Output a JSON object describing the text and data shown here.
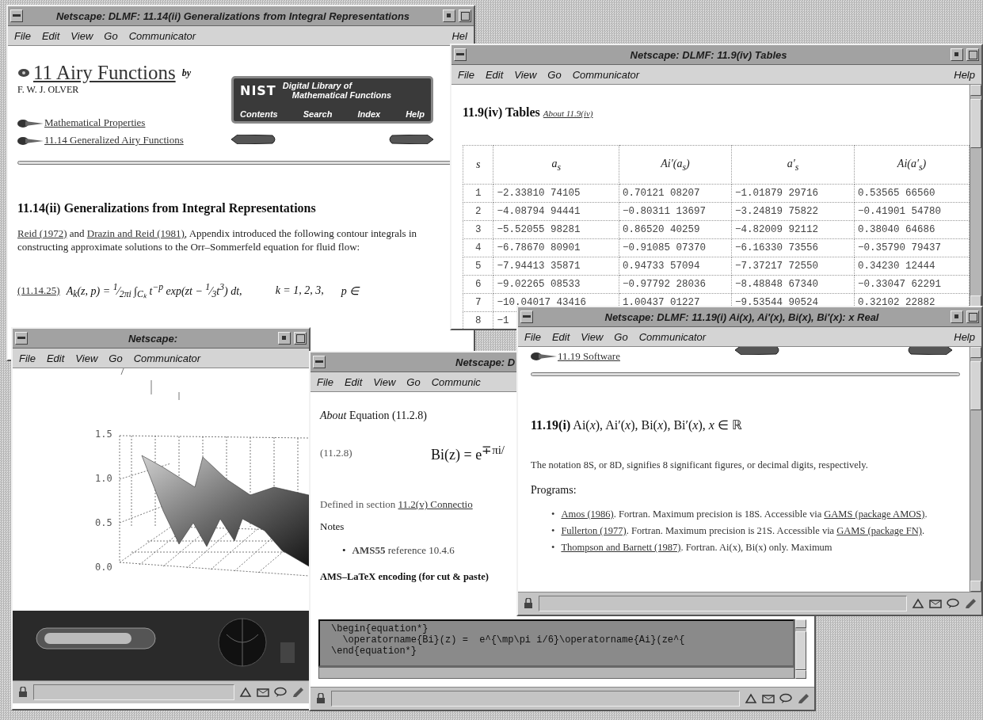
{
  "desktop": {
    "windows": [
      {
        "kind": "toc-page",
        "title": "Netscape: DLMF: 11.14(ii) Generalizations from Integral Representations",
        "menu": [
          "File",
          "Edit",
          "View",
          "Go",
          "Communicator"
        ],
        "help": "Hel",
        "chapter_link": "11 Airy Functions",
        "byline": "by",
        "author": "F. W. J. OLVER",
        "banner": {
          "logo": "NIST",
          "title_1": "Digital Library of",
          "title_2": "Mathematical Functions",
          "links": [
            "Contents",
            "Search",
            "Index",
            "Help"
          ]
        },
        "nav_links": [
          "Mathematical Properties",
          "11.14 Generalized Airy Functions"
        ],
        "heading": "11.14(ii) Generalizations from Integral Representations",
        "paragraph": [
          {
            "text": "Reid (1972)",
            "link": true
          },
          {
            "text": " and ",
            "link": false
          },
          {
            "text": "Drazin and Reid (1981)",
            "link": true
          },
          {
            "text": ", Appendix introduced the following contour integrals in constructing approximate solutions to the Orr–Sommerfeld equation for fluid flow:",
            "link": false
          }
        ],
        "equation": {
          "label": "(11.14.25)",
          "formula": "A$_{k}$(z, p) = $^{1}$⁄$_{2πi}$ ∫$_{Cₖ}$ t$^{−p}$ exp(zt − $^{1}$⁄$_{3}$t$^{3}$) dt,",
          "range": "k = 1, 2, 3,",
          "domain": "p ∈"
        }
      },
      {
        "kind": "table-page",
        "title": "Netscape: DLMF: 11.9(iv) Tables",
        "menu": [
          "File",
          "Edit",
          "View",
          "Go",
          "Communicator"
        ],
        "help": "Help",
        "heading": "11.9(iv) Tables",
        "about_link": "About 11.9(iv)",
        "table": {
          "columns": [
            "s",
            "a$_{s}$",
            "Ai′(a$_{s}$)",
            "a′$_{s}$",
            "Ai(a′$_{s}$)"
          ],
          "rows": [
            [
              "1",
              "−2.33810 74105",
              "0.70121 08207",
              "−1.01879 29716",
              "0.53565 66560"
            ],
            [
              "2",
              "−4.08794 94441",
              "−0.80311 13697",
              "−3.24819 75822",
              "−0.41901 54780"
            ],
            [
              "3",
              "−5.52055 98281",
              "0.86520 40259",
              "−4.82009 92112",
              "0.38040 64686"
            ],
            [
              "4",
              "−6.78670 80901",
              "−0.91085 07370",
              "−6.16330 73556",
              "−0.35790 79437"
            ],
            [
              "5",
              "−7.94413 35871",
              "0.94733 57094",
              "−7.37217 72550",
              "0.34230 12444"
            ],
            [
              "6",
              "−9.02265 08533",
              "−0.97792 28036",
              "−8.48848 67340",
              "−0.33047 62291"
            ],
            [
              "7",
              "−10.04017 43416",
              "1.00437 01227",
              "−9.53544 90524",
              "0.32102 22882"
            ],
            [
              "8",
              "−1"
            ]
          ]
        }
      },
      {
        "kind": "plot-page",
        "title": "Netscape:",
        "menu": [
          "File",
          "Edit",
          "View",
          "Go",
          "Communicator"
        ],
        "plot": {
          "z_ticks": [
            "1.5",
            "1.0",
            "0.5",
            "0.0"
          ]
        }
      },
      {
        "kind": "equation-page",
        "title": "Netscape: D",
        "menu": [
          "File",
          "Edit",
          "View",
          "Go",
          "Communic"
        ],
        "heading_em": "About",
        "heading": "Equation (11.2.8)",
        "equation_label": "(11.2.8)",
        "formula": "Bi(z) = e$^{∓πi/}$",
        "defined": {
          "text": "Defined in section ",
          "link": "11.2(v) Connectio"
        },
        "notes_label": "Notes",
        "notes": [
          {
            "marker": "•",
            "text": "**AMS55** reference 10.4.6"
          }
        ],
        "encoding_label": "AMS–LaTeX encoding (for cut & paste)",
        "code": [
          "\\begin{equation*}",
          "  \\operatorname{Bi}(z) =  e^{\\mp\\pi i/6}\\operatorname{Ai}(ze^{",
          "\\end{equation*}"
        ]
      },
      {
        "kind": "software-page",
        "title": "Netscape: DLMF: 11.19(i) Ai(x), Ai′(x), Bi(x), Bi′(x): x Real",
        "menu": [
          "File",
          "Edit",
          "View",
          "Go",
          "Communicator"
        ],
        "help": "Help",
        "nav_link": "11.19 Software",
        "heading": "**11.19(i)** Ai(*x*), Ai′(*x*), Bi(*x*), Bi′(*x*), *x* ∈ ℝ",
        "paragraph": "The notation 8S, or 8D, signifies 8 significant figures, or decimal digits, respectively.",
        "programs_label": "Programs:",
        "programs": [
          {
            "marker": "•",
            "parts": [
              {
                "text": "Amos (1986)",
                "link": true
              },
              {
                "text": ". Fortran. Maximum precision is 18S. Accessible via ",
                "link": false
              },
              {
                "text": "GAMS (package AMOS)",
                "link": true
              },
              {
                "text": ".",
                "link": false
              }
            ]
          },
          {
            "marker": "•",
            "parts": [
              {
                "text": "Fullerton (1977)",
                "link": true
              },
              {
                "text": ". Fortran. Maximum precision is 21S. Accessible via ",
                "link": false
              },
              {
                "text": "GAMS (package FN)",
                "link": true
              },
              {
                "text": ".",
                "link": false
              }
            ]
          },
          {
            "marker": "•",
            "parts": [
              {
                "text": "Thompson and Barnett (1987)",
                "link": true
              },
              {
                "text": ". Fortran. Ai(x), Bi(x) only. Maximum",
                "link": false
              }
            ]
          }
        ]
      }
    ]
  }
}
